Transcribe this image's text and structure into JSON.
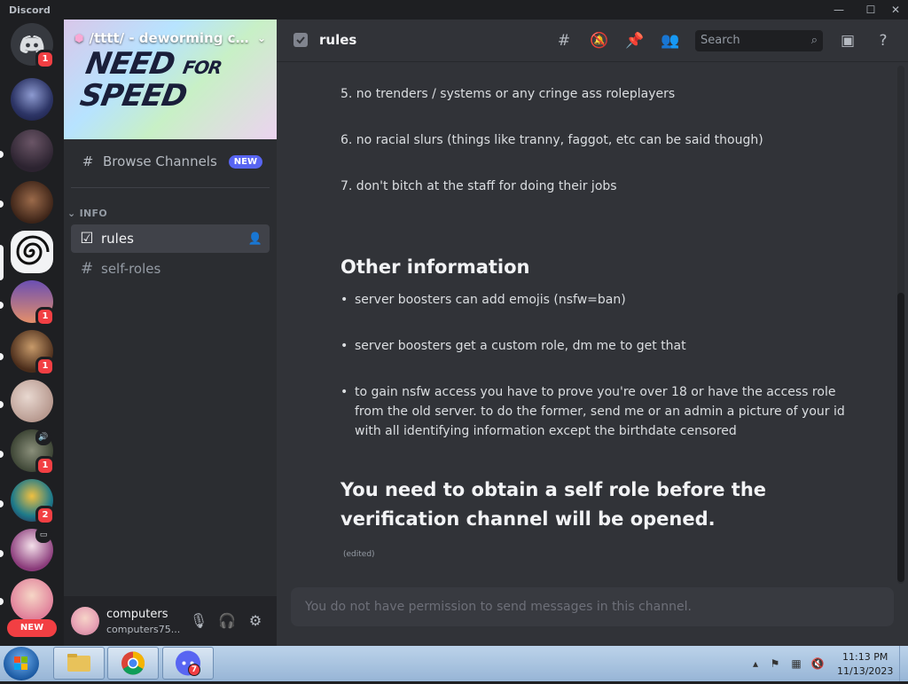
{
  "window": {
    "app_title": "Discord",
    "minimize": "—",
    "maximize": "☐",
    "close": "✕"
  },
  "servers": {
    "home_badge": "1",
    "badges": [
      "1",
      "1",
      "1",
      "2"
    ],
    "new_label": "NEW"
  },
  "sidebar": {
    "server_name": "/tttt/ - deworming cli...",
    "banner_text": "NEED FOR SPEED",
    "browse_label": "Browse Channels",
    "browse_tag": "NEW",
    "category": "INFO",
    "channels": [
      {
        "name": "rules",
        "active": true
      },
      {
        "name": "self-roles",
        "active": false
      }
    ]
  },
  "user": {
    "name": "computers",
    "tag": "computers75..."
  },
  "header": {
    "channel": "rules",
    "search_placeholder": "Search"
  },
  "messages": {
    "rules": [
      "5. no trenders / systems or any cringe ass roleplayers",
      "6. no racial slurs (things like tranny, faggot, etc can be said though)",
      "7. don't bitch at the staff for doing their jobs"
    ],
    "other_heading": "Other information",
    "bullets": [
      "server boosters can add emojis (nsfw=ban)",
      "server boosters get a custom role, dm me to get that",
      "to gain nsfw access you have to prove you're over 18 or have the access role from the old server. to do the former, send me or an admin a picture of your id with all identifying information except the birthdate censored"
    ],
    "self_role_heading": "You need to obtain a self role before the verification channel will be opened.",
    "edited": "(edited)"
  },
  "composer": {
    "placeholder": "You do not have permission to send messages in this channel."
  },
  "taskbar": {
    "time": "11:13 PM",
    "date": "11/13/2023",
    "discord_badge": "7"
  },
  "colors": {
    "accent": "#5865f2",
    "badge": "#f23f43",
    "bg_main": "#313338",
    "bg_sidebar": "#2b2d31"
  }
}
